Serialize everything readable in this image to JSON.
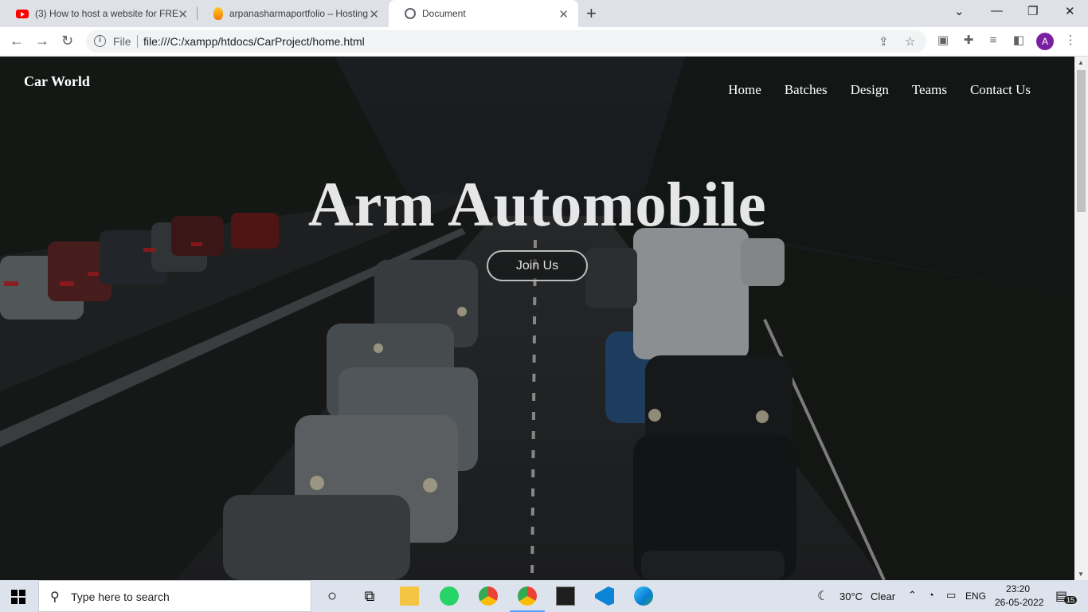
{
  "browser": {
    "tabs": [
      {
        "title": "(3) How to host a website for FREE",
        "icon": "youtube-icon",
        "active": false
      },
      {
        "title": "arpanasharmaportfolio – Hosting",
        "icon": "firebase-icon",
        "active": false
      },
      {
        "title": "Document",
        "icon": "globe-icon",
        "active": true
      }
    ],
    "omnibox": {
      "scheme_label": "File",
      "url": "file:///C:/xampp/htdocs/CarProject/home.html"
    },
    "profile_initial": "A"
  },
  "page": {
    "brand": "Car World",
    "nav": [
      "Home",
      "Batches",
      "Design",
      "Teams",
      "Contact Us"
    ],
    "hero_title": "Arm Automobile",
    "cta_label": "Join Us"
  },
  "taskbar": {
    "search_placeholder": "Type here to search",
    "weather": {
      "temp": "30°C",
      "condition": "Clear"
    },
    "language": "ENG",
    "time": "23:20",
    "date": "26-05-2022",
    "notification_count": "15"
  }
}
